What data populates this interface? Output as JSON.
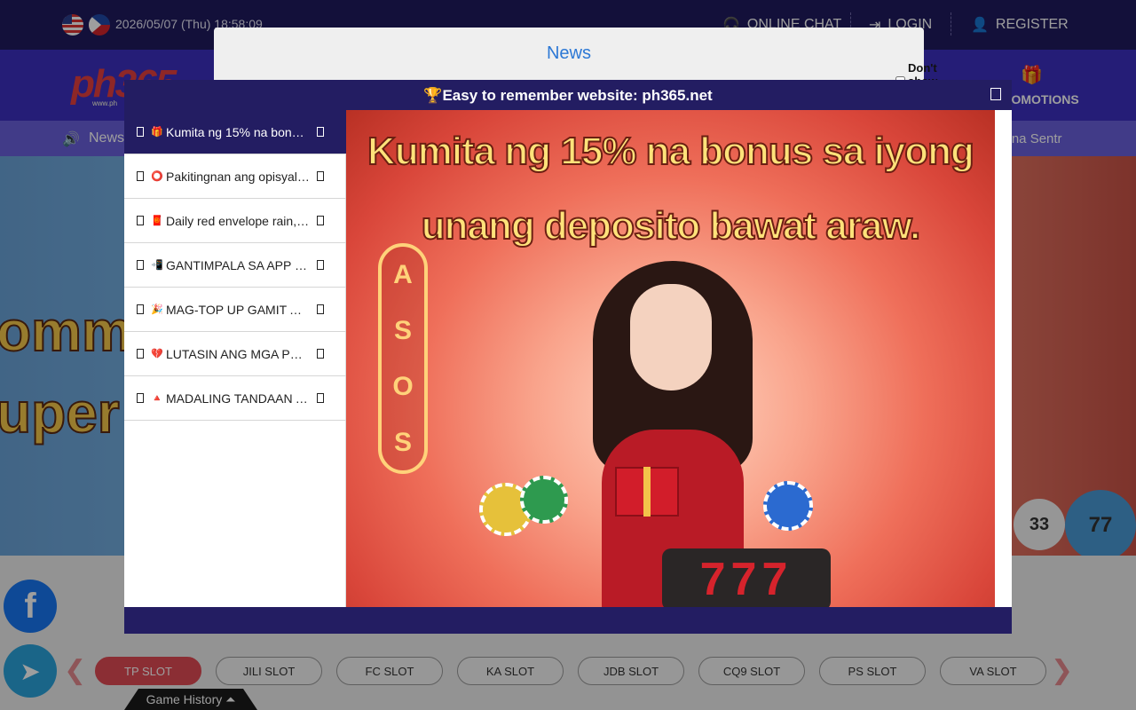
{
  "topbar": {
    "datetime": "2026/05/07 (Thu) 18:58:09",
    "online_chat": "ONLINE CHAT",
    "login": "LOGIN",
    "register": "REGISTER"
  },
  "navbar": {
    "logo": "ph365",
    "logo_sub": "www.ph",
    "promotions": "PROMOTIONS"
  },
  "newsbar": {
    "label": "News",
    "marquee": "al na Sentr"
  },
  "banner": {
    "line1": "ommer",
    "line2": "uper h",
    "ball1": "33",
    "ball2": "77"
  },
  "news_modal": {
    "title": "News",
    "dont_show": "Don't show again"
  },
  "main_modal": {
    "title": "🏆Easy to remember website: ph365.net",
    "items": [
      {
        "emoji": "🎁",
        "label": "Kumita ng 15% na bonus sa iyong unang deposito bawat araw."
      },
      {
        "emoji": "⭕",
        "label": "Pakitingnan ang opisyal na website"
      },
      {
        "emoji": "🧧",
        "label": "Daily red envelope rain, claim now"
      },
      {
        "emoji": "📲",
        "label": "GANTIMPALA SA APP DOWNLOAD"
      },
      {
        "emoji": "🎉",
        "label": "MAG-TOP UP GAMIT ANG GCASH"
      },
      {
        "emoji": "💔",
        "label": "LUTASIN ANG MGA PROBLEMA"
      },
      {
        "emoji": "🔺",
        "label": "MADALING TANDAAN ANG WEBSITE"
      }
    ],
    "promo_line1": "Kumita ng 15% na bonus sa iyong",
    "promo_line2": "unang deposito bawat araw.",
    "promo_slot": "777",
    "promo_casino": [
      "A",
      "S",
      "O",
      "S"
    ]
  },
  "slot_tabs": [
    "TP SLOT",
    "JILI SLOT",
    "FC SLOT",
    "KA SLOT",
    "JDB SLOT",
    "CQ9 SLOT",
    "PS SLOT",
    "VA SLOT"
  ],
  "game_history": "Game History ⏶",
  "colors": {
    "topbar": "#1f1a5e",
    "navbar": "#3c2fc1",
    "modal_header": "#231d62",
    "news_title": "#2c78d5",
    "tab_active": "#e04b55"
  }
}
